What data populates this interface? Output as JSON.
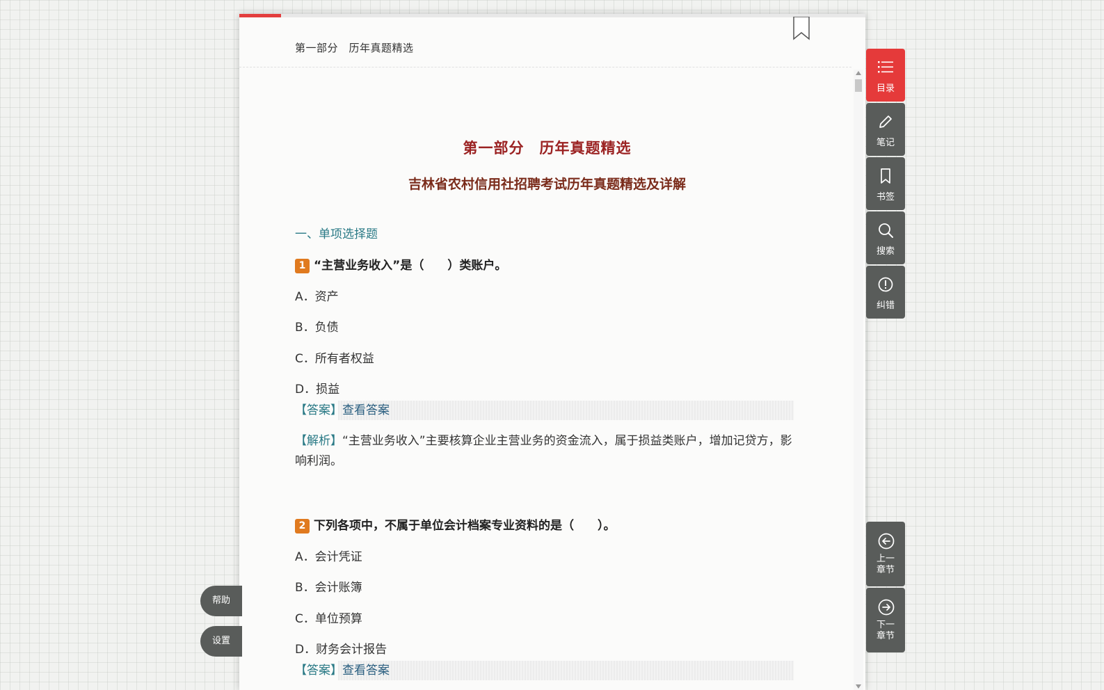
{
  "breadcrumb": "第一部分　历年真题精选",
  "title_main": "第一部分　历年真题精选",
  "title_sub": "吉林省农村信用社招聘考试历年真题精选及详解",
  "section": "一、单项选择题",
  "questions": [
    {
      "num": "1",
      "text": "“主营业务收入”是（　　）类账户。",
      "options": [
        "A．资产",
        "B．负债",
        "C．所有者权益",
        "D．损益"
      ],
      "answer_label": "【答案】",
      "answer_action": "查看答案",
      "analysis_label": "【解析】",
      "analysis_text": "“主营业务收入”主要核算企业主营业务的资金流入，属于损益类账户，增加记贷方，影响利润。"
    },
    {
      "num": "2",
      "text": "下列各项中，不属于单位会计档案专业资料的是（　　）。",
      "options": [
        "A．会计凭证",
        "B．会计账簿",
        "C．单位预算",
        "D．财务会计报告"
      ],
      "answer_label": "【答案】",
      "answer_action": "查看答案"
    }
  ],
  "sidebar": {
    "toc": "目录",
    "notes": "笔记",
    "bookmark": "书签",
    "search": "搜索",
    "report": "纠错",
    "prev_line1": "上一",
    "prev_line2": "章节",
    "next_line1": "下一",
    "next_line2": "章节"
  },
  "help": "帮助",
  "settings": "设置",
  "colors": {
    "accent": "#e53a3a",
    "title": "#9b2222",
    "link": "#2a7a86",
    "badge": "#e07a1f"
  }
}
